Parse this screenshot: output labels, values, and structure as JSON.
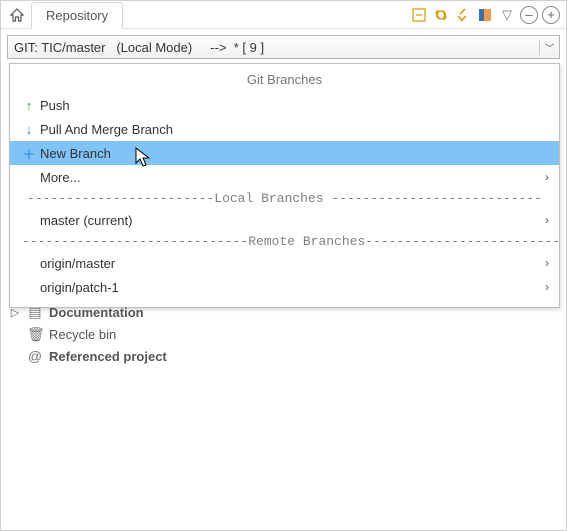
{
  "tab": {
    "title": "Repository"
  },
  "branch_bar": {
    "text": "GIT: TIC/master   (Local Mode)     -->  * [ 9 ]"
  },
  "popup": {
    "title": "Git Branches",
    "push": "Push",
    "pull": "Pull And Merge Branch",
    "new_branch": "New Branch",
    "more": "More...",
    "divider_local": "------------------------Local   Branches ---------------------------",
    "master_current": "master (current)",
    "divider_remote": "-----------------------------Remote Branches------------------------------",
    "remote_master": "origin/master",
    "remote_patch1": "origin/patch-1"
  },
  "tree": {
    "documentation": "Documentation",
    "recycle": "Recycle bin",
    "referenced": "Referenced project"
  }
}
